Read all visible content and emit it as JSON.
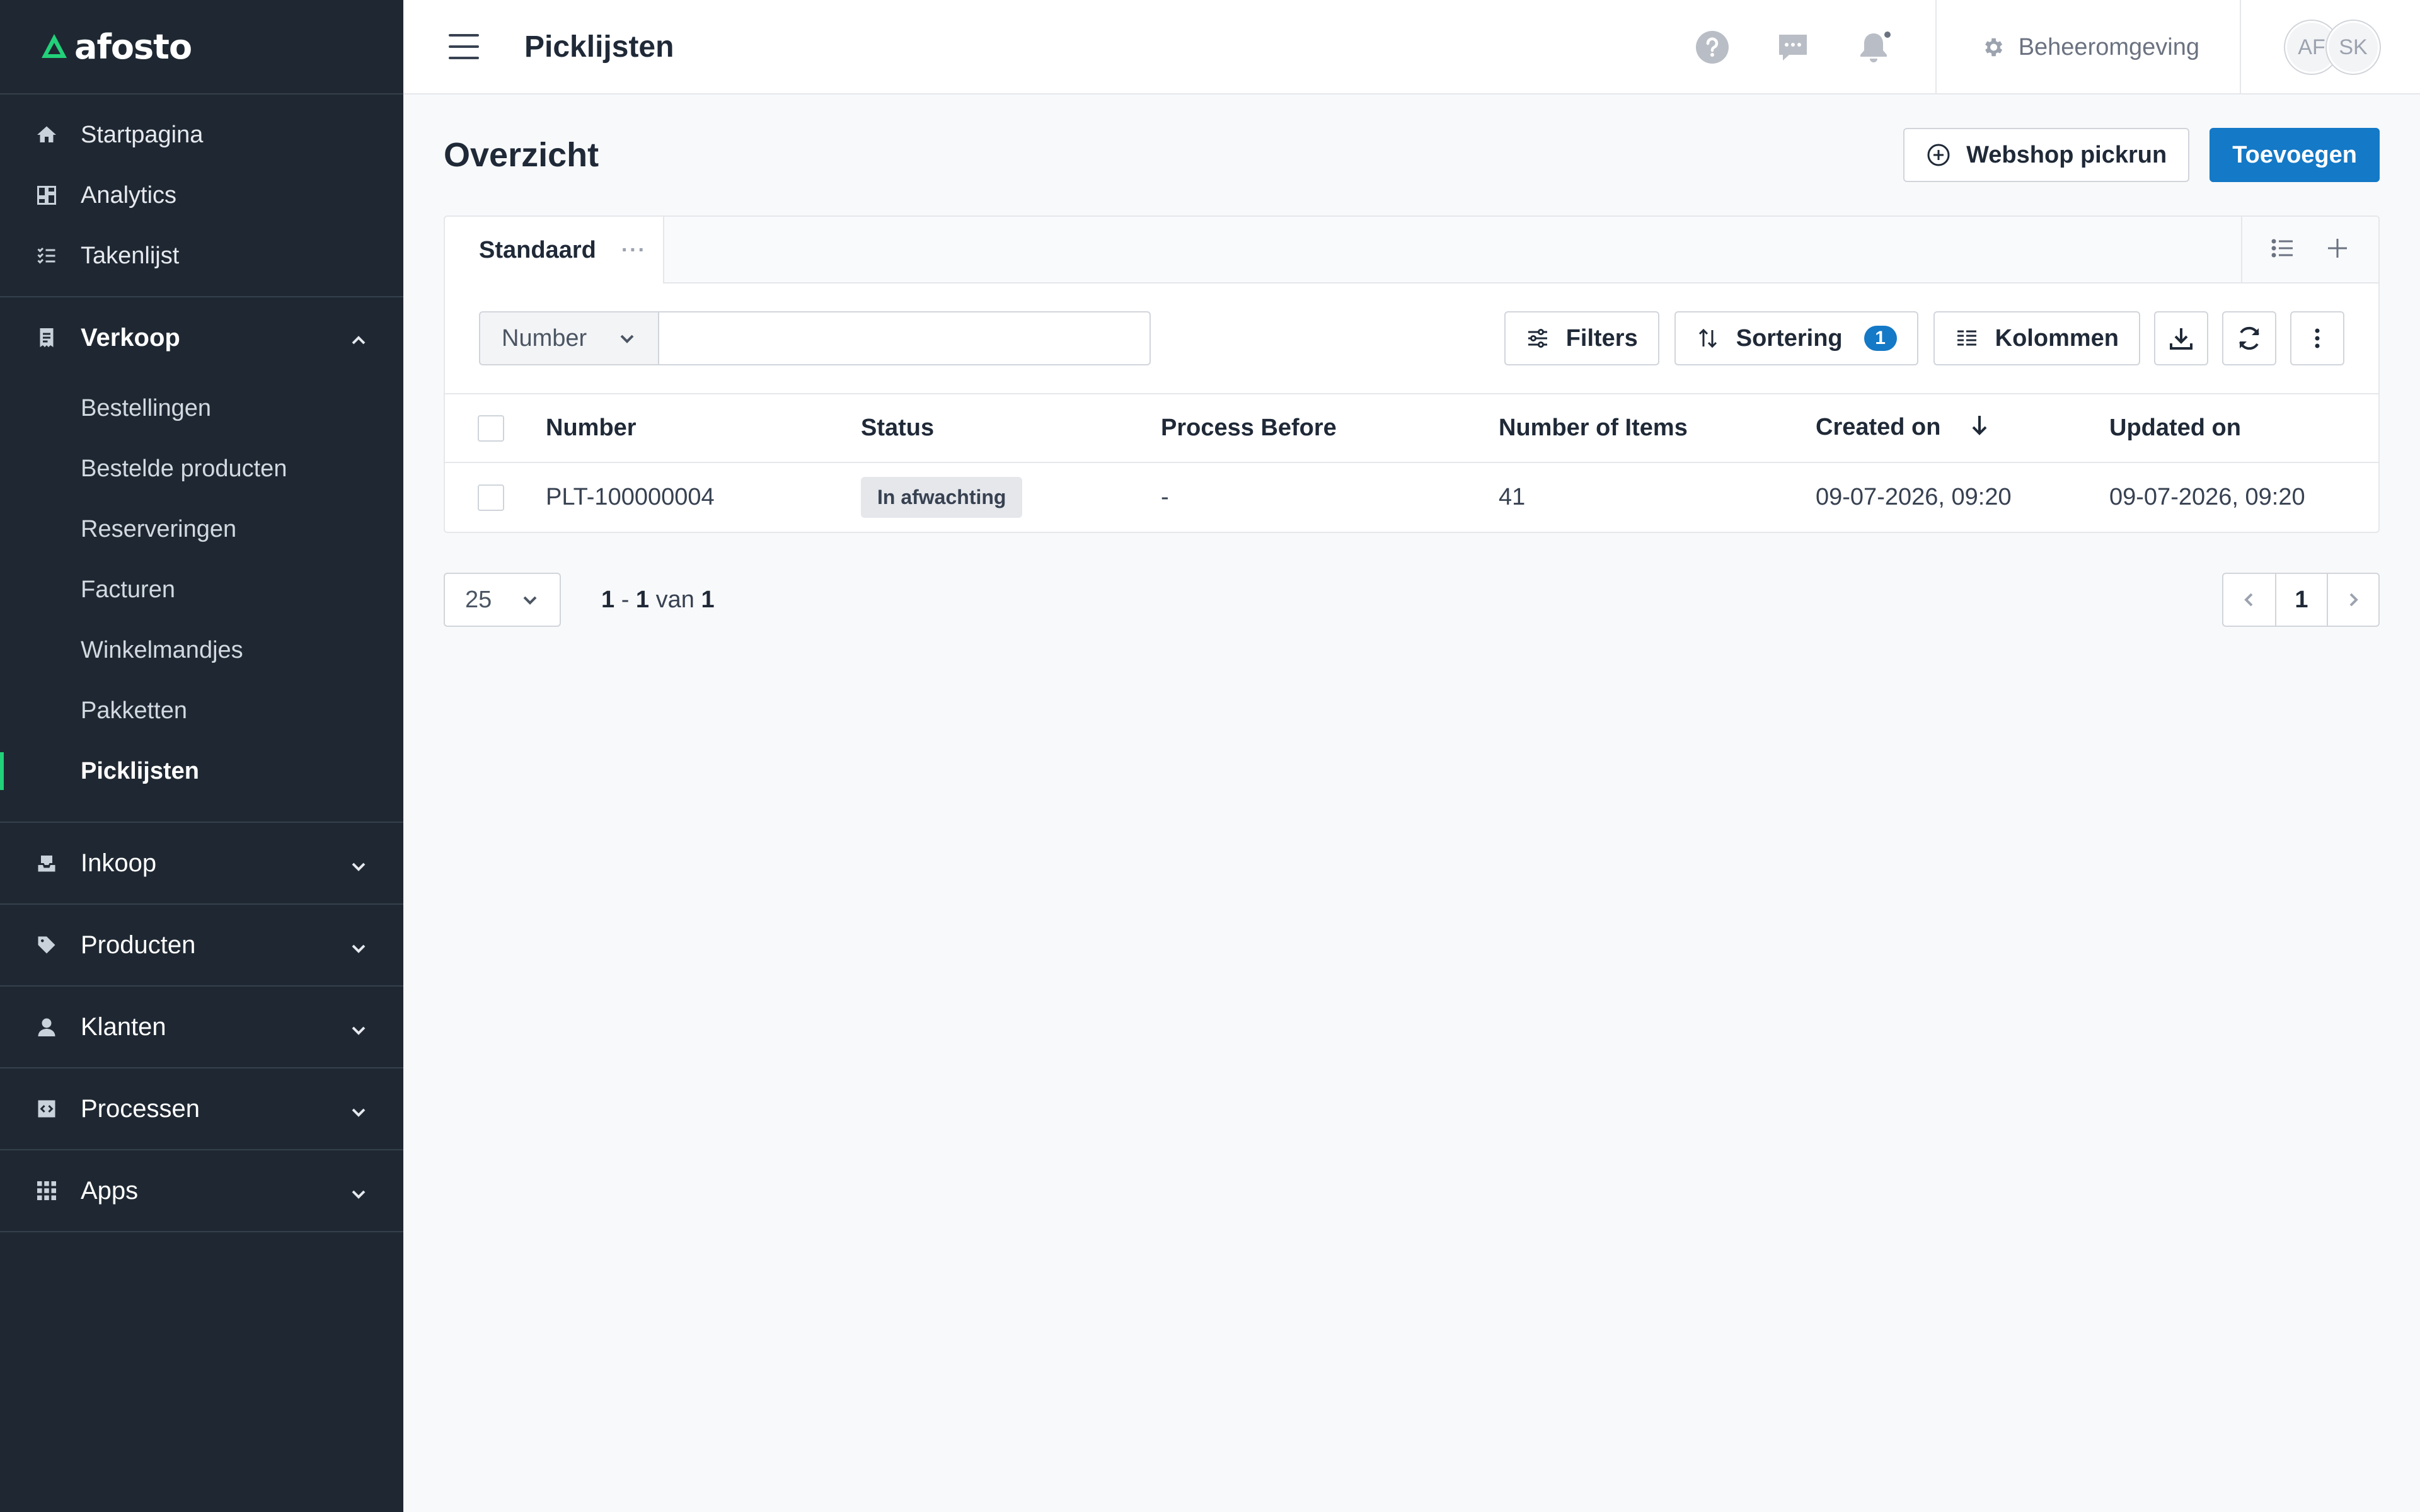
{
  "app": {
    "brand": "afosto",
    "page_title": "Picklijsten"
  },
  "colors": {
    "sidebar_bg": "#1f2832",
    "accent_green": "#22d17a",
    "primary_blue": "#1479c6"
  },
  "sidebar": {
    "top_items": [
      {
        "label": "Startpagina",
        "icon": "home-icon"
      },
      {
        "label": "Analytics",
        "icon": "dashboard-icon"
      },
      {
        "label": "Takenlijst",
        "icon": "checklist-icon"
      }
    ],
    "verkoop": {
      "label": "Verkoop",
      "icon": "receipt-icon",
      "expanded": true,
      "items": [
        {
          "label": "Bestellingen"
        },
        {
          "label": "Bestelde producten"
        },
        {
          "label": "Reserveringen"
        },
        {
          "label": "Facturen"
        },
        {
          "label": "Winkelmandjes"
        },
        {
          "label": "Pakketten"
        },
        {
          "label": "Picklijsten",
          "active": true
        }
      ]
    },
    "sections": [
      {
        "label": "Inkoop",
        "icon": "inbox-icon"
      },
      {
        "label": "Producten",
        "icon": "tag-icon"
      },
      {
        "label": "Klanten",
        "icon": "user-icon"
      },
      {
        "label": "Processen",
        "icon": "code-icon"
      },
      {
        "label": "Apps",
        "icon": "grid-icon"
      }
    ]
  },
  "topbar": {
    "icons": [
      "help-icon",
      "chat-icon",
      "bell-icon"
    ],
    "admin_label": "Beheeromgeving",
    "avatars": [
      "AF",
      "SK"
    ]
  },
  "main": {
    "section_title": "Overzicht",
    "webshop_pickrun_label": "Webshop pickrun",
    "add_label": "Toevoegen",
    "tab_label": "Standaard",
    "filter_field": "Number",
    "search_value": "",
    "filters_label": "Filters",
    "sorting_label": "Sortering",
    "sorting_count": "1",
    "columns_label": "Kolommen",
    "table": {
      "headers": {
        "number": "Number",
        "status": "Status",
        "process_before": "Process Before",
        "items": "Number of Items",
        "created": "Created on",
        "updated": "Updated on"
      },
      "rows": [
        {
          "number": "PLT-100000004",
          "status": "In afwachting",
          "process_before": "-",
          "items": "41",
          "created": "09-07-2026, 09:20",
          "updated": "09-07-2026, 09:20"
        }
      ]
    },
    "pagination": {
      "per_page": "25",
      "range_start": "1",
      "range_end": "1",
      "range_of": "van",
      "total": "1",
      "current_page": "1"
    }
  }
}
